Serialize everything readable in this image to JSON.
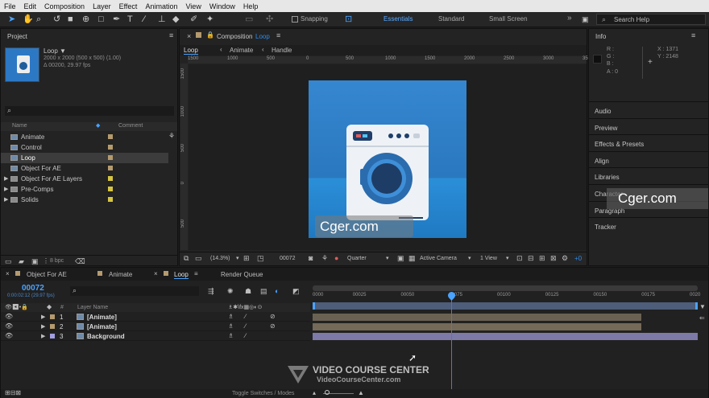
{
  "menu": [
    "File",
    "Edit",
    "Composition",
    "Layer",
    "Effect",
    "Animation",
    "View",
    "Window",
    "Help"
  ],
  "toolbar": {
    "snapping": "Snapping",
    "workspaces": [
      "Essentials",
      "Standard",
      "Small Screen"
    ],
    "more": "»",
    "search_placeholder": "Search Help"
  },
  "project": {
    "title": "Project",
    "comp_name": "Loop ▼",
    "comp_size": "2000 x 2000  (500 x 500) (1.00)",
    "comp_duration": "Δ 00200, 29.97 fps",
    "col_name": "Name",
    "col_comment": "Comment",
    "items": [
      {
        "label": "Animate",
        "type": "comp",
        "color": "#b49a6e"
      },
      {
        "label": "Control",
        "type": "comp",
        "color": "#b49a6e"
      },
      {
        "label": "Loop",
        "type": "comp",
        "color": "#b49a6e",
        "selected": true
      },
      {
        "label": "Object For AE",
        "type": "comp",
        "color": "#b49a6e"
      },
      {
        "label": "Object For AE Layers",
        "type": "folder",
        "color": "#d6c542"
      },
      {
        "label": "Pre-Comps",
        "type": "folder",
        "color": "#d6c542"
      },
      {
        "label": "Solids",
        "type": "folder",
        "color": "#d6c542"
      }
    ],
    "bpc": "8 bpc"
  },
  "comp": {
    "title": "Composition",
    "title_name": "Loop",
    "menu": "≡",
    "crumbs": [
      "Loop",
      "Animate",
      "Handle"
    ],
    "ruler_ticks": [
      "1500",
      "1000",
      "500",
      "0",
      "500",
      "1000",
      "1500",
      "2000",
      "2500",
      "3000",
      "3500"
    ],
    "zoom": "(14.3%)",
    "timecode": "00072",
    "resolution": "Quarter",
    "camera": "Active Camera",
    "views": "1 View",
    "exposure": "+0"
  },
  "info": {
    "title": "Info",
    "r": "R :",
    "g": "G :",
    "b": "B :",
    "a": "A : 0",
    "x": "X : 1371",
    "y": "Y : 2148",
    "panels": [
      "Audio",
      "Preview",
      "Effects & Presets",
      "Align",
      "Libraries",
      "Character",
      "Paragraph",
      "Tracker"
    ]
  },
  "timeline": {
    "tabs": [
      "Object For AE",
      "Animate",
      "Loop",
      "Render Queue"
    ],
    "timecode": "00072",
    "timecode_sub": "0:00:02:12 (29.97 fps)",
    "col_num": "#",
    "col_layer": "Layer Name",
    "ticks": [
      "0000",
      "00025",
      "00050",
      "00075",
      "00100",
      "00125",
      "00150",
      "00175",
      "0020"
    ],
    "playhead_frame": 72,
    "total_frames": 200,
    "layers": [
      {
        "num": "1",
        "name": "[Animate]",
        "color": "#b49a6e"
      },
      {
        "num": "2",
        "name": "[Animate]",
        "color": "#b49a6e"
      },
      {
        "num": "3",
        "name": "Background",
        "color": "#a39ee0"
      }
    ],
    "toggle": "Toggle Switches / Modes"
  },
  "watermarks": {
    "cger": "Cger.com",
    "vcc_title": "VIDEO COURSE CENTER",
    "vcc_sub": "VideoCourseCenter.com"
  }
}
